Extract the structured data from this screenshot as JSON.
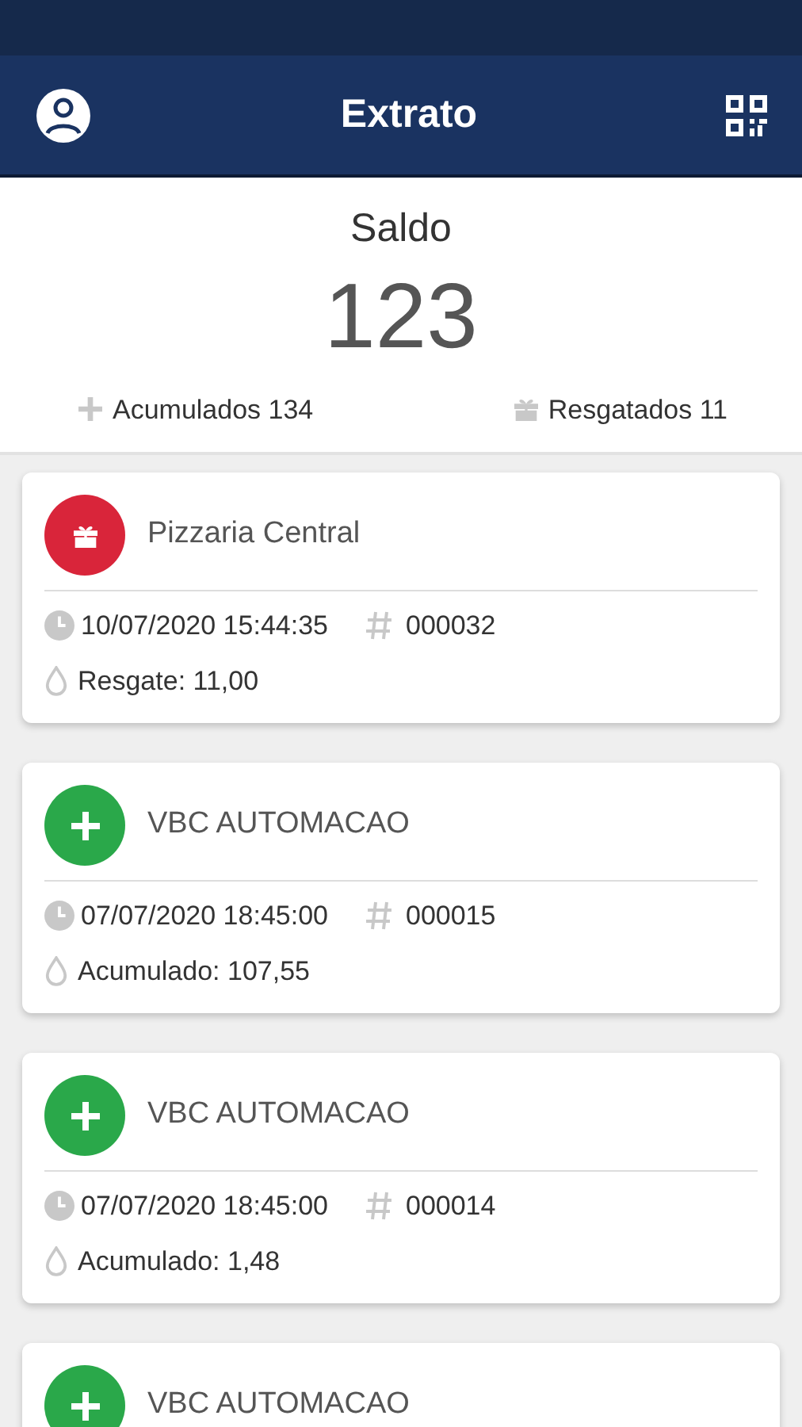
{
  "header": {
    "title": "Extrato"
  },
  "summary": {
    "label": "Saldo",
    "balance": "123",
    "accumulated": "Acumulados 134",
    "redeemed": "Resgatados 11"
  },
  "transactions": [
    {
      "kind": "redeem",
      "store": "Pizzaria Central",
      "datetime": "10/07/2020 15:44:35",
      "number": "000032",
      "amount": "Resgate: 11,00"
    },
    {
      "kind": "accumulate",
      "store": "VBC AUTOMACAO",
      "datetime": "07/07/2020 18:45:00",
      "number": "000015",
      "amount": "Acumulado: 107,55"
    },
    {
      "kind": "accumulate",
      "store": "VBC AUTOMACAO",
      "datetime": "07/07/2020 18:45:00",
      "number": "000014",
      "amount": "Acumulado: 1,48"
    },
    {
      "kind": "accumulate",
      "store": "VBC AUTOMACAO"
    }
  ]
}
